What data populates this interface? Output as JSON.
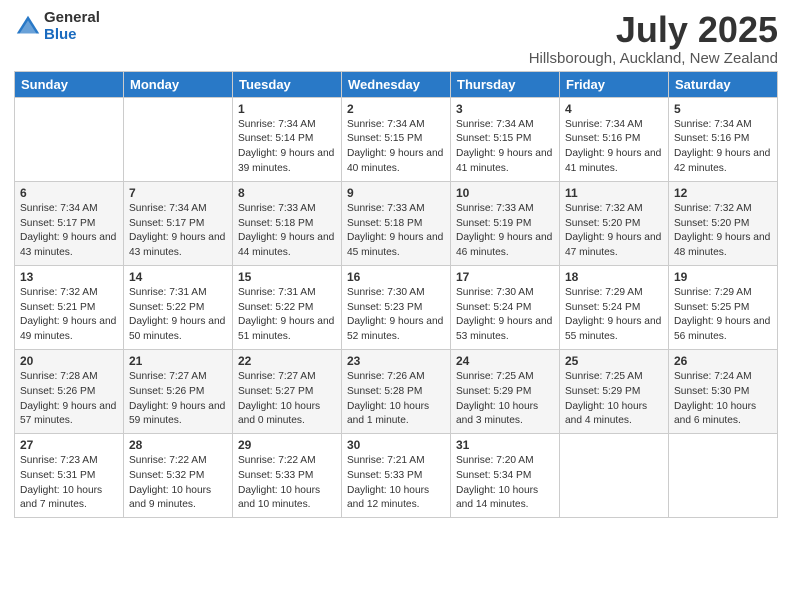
{
  "logo": {
    "general": "General",
    "blue": "Blue"
  },
  "title": "July 2025",
  "location": "Hillsborough, Auckland, New Zealand",
  "days_of_week": [
    "Sunday",
    "Monday",
    "Tuesday",
    "Wednesday",
    "Thursday",
    "Friday",
    "Saturday"
  ],
  "weeks": [
    [
      null,
      null,
      {
        "day": "1",
        "sunrise": "7:34 AM",
        "sunset": "5:14 PM",
        "daylight": "9 hours and 39 minutes."
      },
      {
        "day": "2",
        "sunrise": "7:34 AM",
        "sunset": "5:15 PM",
        "daylight": "9 hours and 40 minutes."
      },
      {
        "day": "3",
        "sunrise": "7:34 AM",
        "sunset": "5:15 PM",
        "daylight": "9 hours and 41 minutes."
      },
      {
        "day": "4",
        "sunrise": "7:34 AM",
        "sunset": "5:16 PM",
        "daylight": "9 hours and 41 minutes."
      },
      {
        "day": "5",
        "sunrise": "7:34 AM",
        "sunset": "5:16 PM",
        "daylight": "9 hours and 42 minutes."
      }
    ],
    [
      {
        "day": "6",
        "sunrise": "7:34 AM",
        "sunset": "5:17 PM",
        "daylight": "9 hours and 43 minutes."
      },
      {
        "day": "7",
        "sunrise": "7:34 AM",
        "sunset": "5:17 PM",
        "daylight": "9 hours and 43 minutes."
      },
      {
        "day": "8",
        "sunrise": "7:33 AM",
        "sunset": "5:18 PM",
        "daylight": "9 hours and 44 minutes."
      },
      {
        "day": "9",
        "sunrise": "7:33 AM",
        "sunset": "5:18 PM",
        "daylight": "9 hours and 45 minutes."
      },
      {
        "day": "10",
        "sunrise": "7:33 AM",
        "sunset": "5:19 PM",
        "daylight": "9 hours and 46 minutes."
      },
      {
        "day": "11",
        "sunrise": "7:32 AM",
        "sunset": "5:20 PM",
        "daylight": "9 hours and 47 minutes."
      },
      {
        "day": "12",
        "sunrise": "7:32 AM",
        "sunset": "5:20 PM",
        "daylight": "9 hours and 48 minutes."
      }
    ],
    [
      {
        "day": "13",
        "sunrise": "7:32 AM",
        "sunset": "5:21 PM",
        "daylight": "9 hours and 49 minutes."
      },
      {
        "day": "14",
        "sunrise": "7:31 AM",
        "sunset": "5:22 PM",
        "daylight": "9 hours and 50 minutes."
      },
      {
        "day": "15",
        "sunrise": "7:31 AM",
        "sunset": "5:22 PM",
        "daylight": "9 hours and 51 minutes."
      },
      {
        "day": "16",
        "sunrise": "7:30 AM",
        "sunset": "5:23 PM",
        "daylight": "9 hours and 52 minutes."
      },
      {
        "day": "17",
        "sunrise": "7:30 AM",
        "sunset": "5:24 PM",
        "daylight": "9 hours and 53 minutes."
      },
      {
        "day": "18",
        "sunrise": "7:29 AM",
        "sunset": "5:24 PM",
        "daylight": "9 hours and 55 minutes."
      },
      {
        "day": "19",
        "sunrise": "7:29 AM",
        "sunset": "5:25 PM",
        "daylight": "9 hours and 56 minutes."
      }
    ],
    [
      {
        "day": "20",
        "sunrise": "7:28 AM",
        "sunset": "5:26 PM",
        "daylight": "9 hours and 57 minutes."
      },
      {
        "day": "21",
        "sunrise": "7:27 AM",
        "sunset": "5:26 PM",
        "daylight": "9 hours and 59 minutes."
      },
      {
        "day": "22",
        "sunrise": "7:27 AM",
        "sunset": "5:27 PM",
        "daylight": "10 hours and 0 minutes."
      },
      {
        "day": "23",
        "sunrise": "7:26 AM",
        "sunset": "5:28 PM",
        "daylight": "10 hours and 1 minute."
      },
      {
        "day": "24",
        "sunrise": "7:25 AM",
        "sunset": "5:29 PM",
        "daylight": "10 hours and 3 minutes."
      },
      {
        "day": "25",
        "sunrise": "7:25 AM",
        "sunset": "5:29 PM",
        "daylight": "10 hours and 4 minutes."
      },
      {
        "day": "26",
        "sunrise": "7:24 AM",
        "sunset": "5:30 PM",
        "daylight": "10 hours and 6 minutes."
      }
    ],
    [
      {
        "day": "27",
        "sunrise": "7:23 AM",
        "sunset": "5:31 PM",
        "daylight": "10 hours and 7 minutes."
      },
      {
        "day": "28",
        "sunrise": "7:22 AM",
        "sunset": "5:32 PM",
        "daylight": "10 hours and 9 minutes."
      },
      {
        "day": "29",
        "sunrise": "7:22 AM",
        "sunset": "5:33 PM",
        "daylight": "10 hours and 10 minutes."
      },
      {
        "day": "30",
        "sunrise": "7:21 AM",
        "sunset": "5:33 PM",
        "daylight": "10 hours and 12 minutes."
      },
      {
        "day": "31",
        "sunrise": "7:20 AM",
        "sunset": "5:34 PM",
        "daylight": "10 hours and 14 minutes."
      },
      null,
      null
    ]
  ]
}
